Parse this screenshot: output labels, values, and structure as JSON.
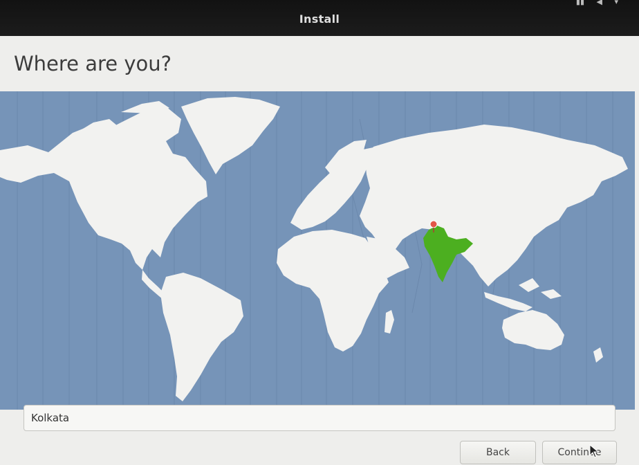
{
  "window": {
    "title": "Install"
  },
  "page": {
    "heading": "Where are you?"
  },
  "map": {
    "selected_region": "India",
    "selected_color": "#4caf20",
    "land_color": "#f2f2f0",
    "ocean_color": "#7694b8"
  },
  "location": {
    "value": "Kolkata"
  },
  "buttons": {
    "back_label": "Back",
    "continue_label": "Continue"
  },
  "icons": {
    "pin": "map-pin-icon",
    "cursor": "mouse-pointer-icon"
  }
}
